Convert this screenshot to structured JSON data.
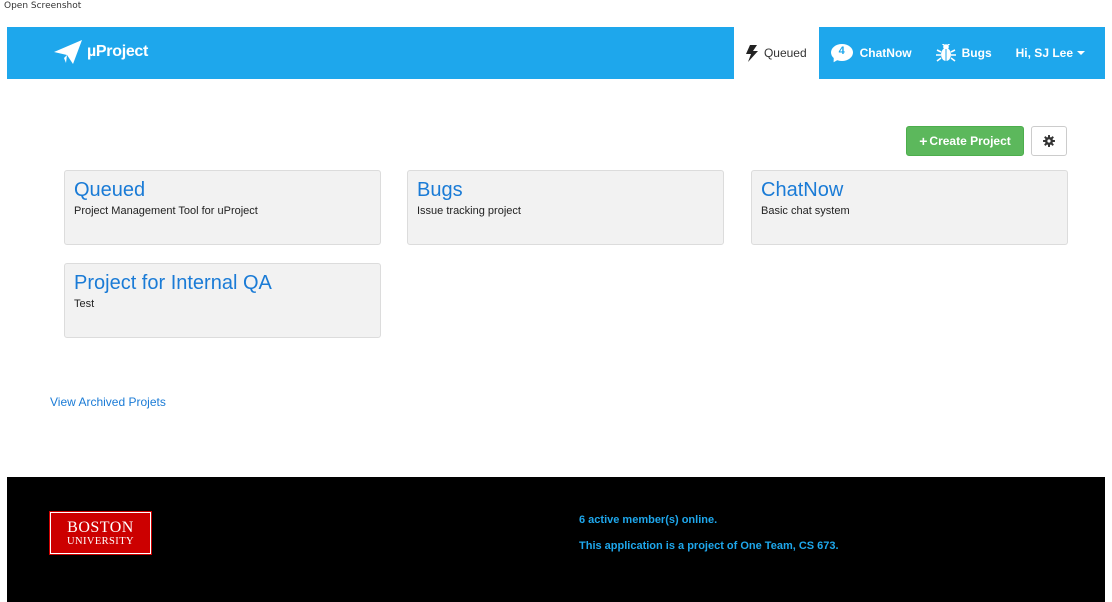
{
  "caption": "Open Screenshot",
  "brand": {
    "name": "µProject"
  },
  "nav": {
    "queued_label": "Queued",
    "chat_label": "ChatNow",
    "chat_count": "4",
    "bugs_label": "Bugs",
    "user_label": "Hi, SJ Lee"
  },
  "actions": {
    "create_label": "Create Project"
  },
  "projects": [
    {
      "title": "Queued",
      "description": "Project Management Tool for uProject"
    },
    {
      "title": "Bugs",
      "description": "Issue tracking project"
    },
    {
      "title": "ChatNow",
      "description": "Basic chat system"
    },
    {
      "title": "Project for Internal QA",
      "description": "Test"
    }
  ],
  "archived_link": "View Archived Projets",
  "footer": {
    "logo_line1": "BOSTON",
    "logo_line2": "UNIVERSITY",
    "online": "6 active member(s) online.",
    "credit": "This application is a project of One Team, CS 673."
  },
  "colors": {
    "nav": "#1ea7ec",
    "create_button": "#5cb85c",
    "link": "#1a7bd6",
    "footer_bg": "#000000",
    "logo_red": "#cc0000"
  }
}
